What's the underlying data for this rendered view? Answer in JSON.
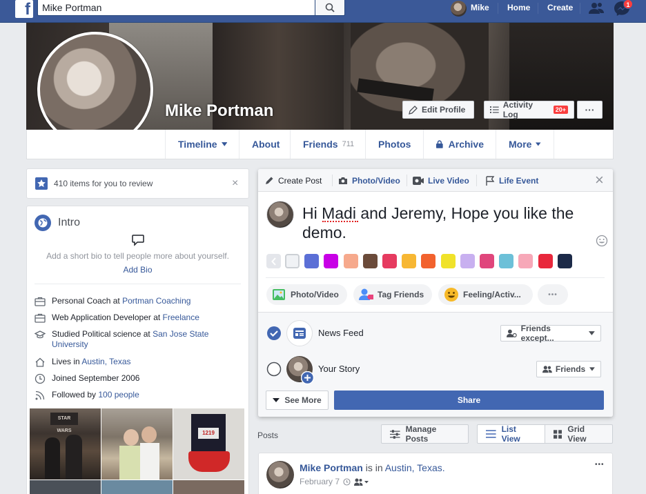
{
  "topbar": {
    "logo": "f",
    "search_value": "Mike Portman",
    "user_name": "Mike",
    "home_label": "Home",
    "create_label": "Create",
    "notification_count": "1"
  },
  "profile": {
    "name": "Mike Portman",
    "edit_profile_label": "Edit Profile",
    "activity_log_label": "Activity Log",
    "activity_badge": "20+",
    "more_dots": "···"
  },
  "tabs": [
    {
      "label": "Timeline"
    },
    {
      "label": "About"
    },
    {
      "label": "Friends",
      "count": "711"
    },
    {
      "label": "Photos"
    },
    {
      "label": "Archive"
    },
    {
      "label": "More"
    }
  ],
  "review": {
    "text": "410 items for you to review",
    "close": "×"
  },
  "intro": {
    "title": "Intro",
    "bio_prompt": "Add a short bio to tell people more about yourself.",
    "add_bio": "Add Bio",
    "items": [
      {
        "prefix": "Personal Coach at ",
        "link": "Portman Coaching"
      },
      {
        "prefix": "Web Application Developer at ",
        "link": "Freelance"
      },
      {
        "prefix": "Studied Political science at ",
        "link": "San Jose State University"
      },
      {
        "prefix": "Lives in ",
        "link": "Austin, Texas"
      },
      {
        "prefix": "Joined September 2006",
        "link": ""
      },
      {
        "prefix": "Followed by ",
        "link": "100 people"
      }
    ]
  },
  "composer": {
    "tabs": [
      {
        "label": "Create Post"
      },
      {
        "label": "Photo/Video"
      },
      {
        "label": "Live Video"
      },
      {
        "label": "Life Event"
      }
    ],
    "close": "×",
    "post_text": "Hi Madi and Jeremy, Hope you like the demo.",
    "swatches": [
      "#f0f2f5",
      "#5b6fd6",
      "#c800e6",
      "#f6a98c",
      "#6b4b3a",
      "#e63b60",
      "#f7b733",
      "#f2622e",
      "#f0e22a",
      "#c8b0f0",
      "#e0467c",
      "#6cc0d8",
      "#f7a8b8",
      "#e8283c",
      "#1c2a48"
    ],
    "chips": [
      {
        "label": "Photo/Video"
      },
      {
        "label": "Tag Friends"
      },
      {
        "label": "Feeling/Activ..."
      }
    ],
    "chip_more": "•••",
    "news_feed_label": "News Feed",
    "news_feed_audience": "Friends except...",
    "story_label": "Your Story",
    "story_audience": "Friends",
    "see_more_label": "See More",
    "share_label": "Share"
  },
  "posts": {
    "header": "Posts",
    "manage_label": "Manage Posts",
    "list_view_label": "List View",
    "grid_view_label": "Grid View"
  },
  "post": {
    "author": "Mike Portman",
    "action": " is in ",
    "place": "Austin, Texas.",
    "date": "February 7",
    "more": "•••"
  }
}
